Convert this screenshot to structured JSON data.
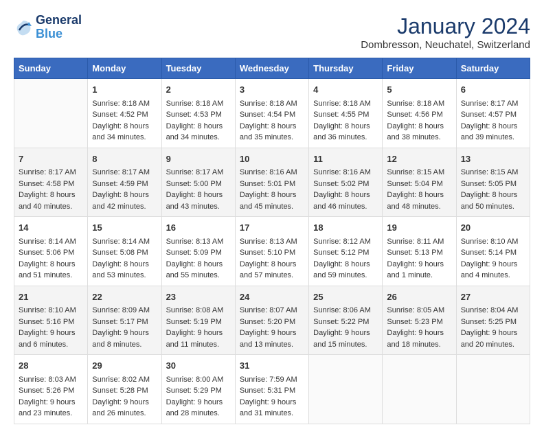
{
  "header": {
    "logo_line1": "General",
    "logo_line2": "Blue",
    "month": "January 2024",
    "location": "Dombresson, Neuchatel, Switzerland"
  },
  "weekdays": [
    "Sunday",
    "Monday",
    "Tuesday",
    "Wednesday",
    "Thursday",
    "Friday",
    "Saturday"
  ],
  "weeks": [
    [
      {
        "day": "",
        "content": ""
      },
      {
        "day": "1",
        "content": "Sunrise: 8:18 AM\nSunset: 4:52 PM\nDaylight: 8 hours\nand 34 minutes."
      },
      {
        "day": "2",
        "content": "Sunrise: 8:18 AM\nSunset: 4:53 PM\nDaylight: 8 hours\nand 34 minutes."
      },
      {
        "day": "3",
        "content": "Sunrise: 8:18 AM\nSunset: 4:54 PM\nDaylight: 8 hours\nand 35 minutes."
      },
      {
        "day": "4",
        "content": "Sunrise: 8:18 AM\nSunset: 4:55 PM\nDaylight: 8 hours\nand 36 minutes."
      },
      {
        "day": "5",
        "content": "Sunrise: 8:18 AM\nSunset: 4:56 PM\nDaylight: 8 hours\nand 38 minutes."
      },
      {
        "day": "6",
        "content": "Sunrise: 8:17 AM\nSunset: 4:57 PM\nDaylight: 8 hours\nand 39 minutes."
      }
    ],
    [
      {
        "day": "7",
        "content": "Sunrise: 8:17 AM\nSunset: 4:58 PM\nDaylight: 8 hours\nand 40 minutes."
      },
      {
        "day": "8",
        "content": "Sunrise: 8:17 AM\nSunset: 4:59 PM\nDaylight: 8 hours\nand 42 minutes."
      },
      {
        "day": "9",
        "content": "Sunrise: 8:17 AM\nSunset: 5:00 PM\nDaylight: 8 hours\nand 43 minutes."
      },
      {
        "day": "10",
        "content": "Sunrise: 8:16 AM\nSunset: 5:01 PM\nDaylight: 8 hours\nand 45 minutes."
      },
      {
        "day": "11",
        "content": "Sunrise: 8:16 AM\nSunset: 5:02 PM\nDaylight: 8 hours\nand 46 minutes."
      },
      {
        "day": "12",
        "content": "Sunrise: 8:15 AM\nSunset: 5:04 PM\nDaylight: 8 hours\nand 48 minutes."
      },
      {
        "day": "13",
        "content": "Sunrise: 8:15 AM\nSunset: 5:05 PM\nDaylight: 8 hours\nand 50 minutes."
      }
    ],
    [
      {
        "day": "14",
        "content": "Sunrise: 8:14 AM\nSunset: 5:06 PM\nDaylight: 8 hours\nand 51 minutes."
      },
      {
        "day": "15",
        "content": "Sunrise: 8:14 AM\nSunset: 5:08 PM\nDaylight: 8 hours\nand 53 minutes."
      },
      {
        "day": "16",
        "content": "Sunrise: 8:13 AM\nSunset: 5:09 PM\nDaylight: 8 hours\nand 55 minutes."
      },
      {
        "day": "17",
        "content": "Sunrise: 8:13 AM\nSunset: 5:10 PM\nDaylight: 8 hours\nand 57 minutes."
      },
      {
        "day": "18",
        "content": "Sunrise: 8:12 AM\nSunset: 5:12 PM\nDaylight: 8 hours\nand 59 minutes."
      },
      {
        "day": "19",
        "content": "Sunrise: 8:11 AM\nSunset: 5:13 PM\nDaylight: 9 hours\nand 1 minute."
      },
      {
        "day": "20",
        "content": "Sunrise: 8:10 AM\nSunset: 5:14 PM\nDaylight: 9 hours\nand 4 minutes."
      }
    ],
    [
      {
        "day": "21",
        "content": "Sunrise: 8:10 AM\nSunset: 5:16 PM\nDaylight: 9 hours\nand 6 minutes."
      },
      {
        "day": "22",
        "content": "Sunrise: 8:09 AM\nSunset: 5:17 PM\nDaylight: 9 hours\nand 8 minutes."
      },
      {
        "day": "23",
        "content": "Sunrise: 8:08 AM\nSunset: 5:19 PM\nDaylight: 9 hours\nand 11 minutes."
      },
      {
        "day": "24",
        "content": "Sunrise: 8:07 AM\nSunset: 5:20 PM\nDaylight: 9 hours\nand 13 minutes."
      },
      {
        "day": "25",
        "content": "Sunrise: 8:06 AM\nSunset: 5:22 PM\nDaylight: 9 hours\nand 15 minutes."
      },
      {
        "day": "26",
        "content": "Sunrise: 8:05 AM\nSunset: 5:23 PM\nDaylight: 9 hours\nand 18 minutes."
      },
      {
        "day": "27",
        "content": "Sunrise: 8:04 AM\nSunset: 5:25 PM\nDaylight: 9 hours\nand 20 minutes."
      }
    ],
    [
      {
        "day": "28",
        "content": "Sunrise: 8:03 AM\nSunset: 5:26 PM\nDaylight: 9 hours\nand 23 minutes."
      },
      {
        "day": "29",
        "content": "Sunrise: 8:02 AM\nSunset: 5:28 PM\nDaylight: 9 hours\nand 26 minutes."
      },
      {
        "day": "30",
        "content": "Sunrise: 8:00 AM\nSunset: 5:29 PM\nDaylight: 9 hours\nand 28 minutes."
      },
      {
        "day": "31",
        "content": "Sunrise: 7:59 AM\nSunset: 5:31 PM\nDaylight: 9 hours\nand 31 minutes."
      },
      {
        "day": "",
        "content": ""
      },
      {
        "day": "",
        "content": ""
      },
      {
        "day": "",
        "content": ""
      }
    ]
  ]
}
